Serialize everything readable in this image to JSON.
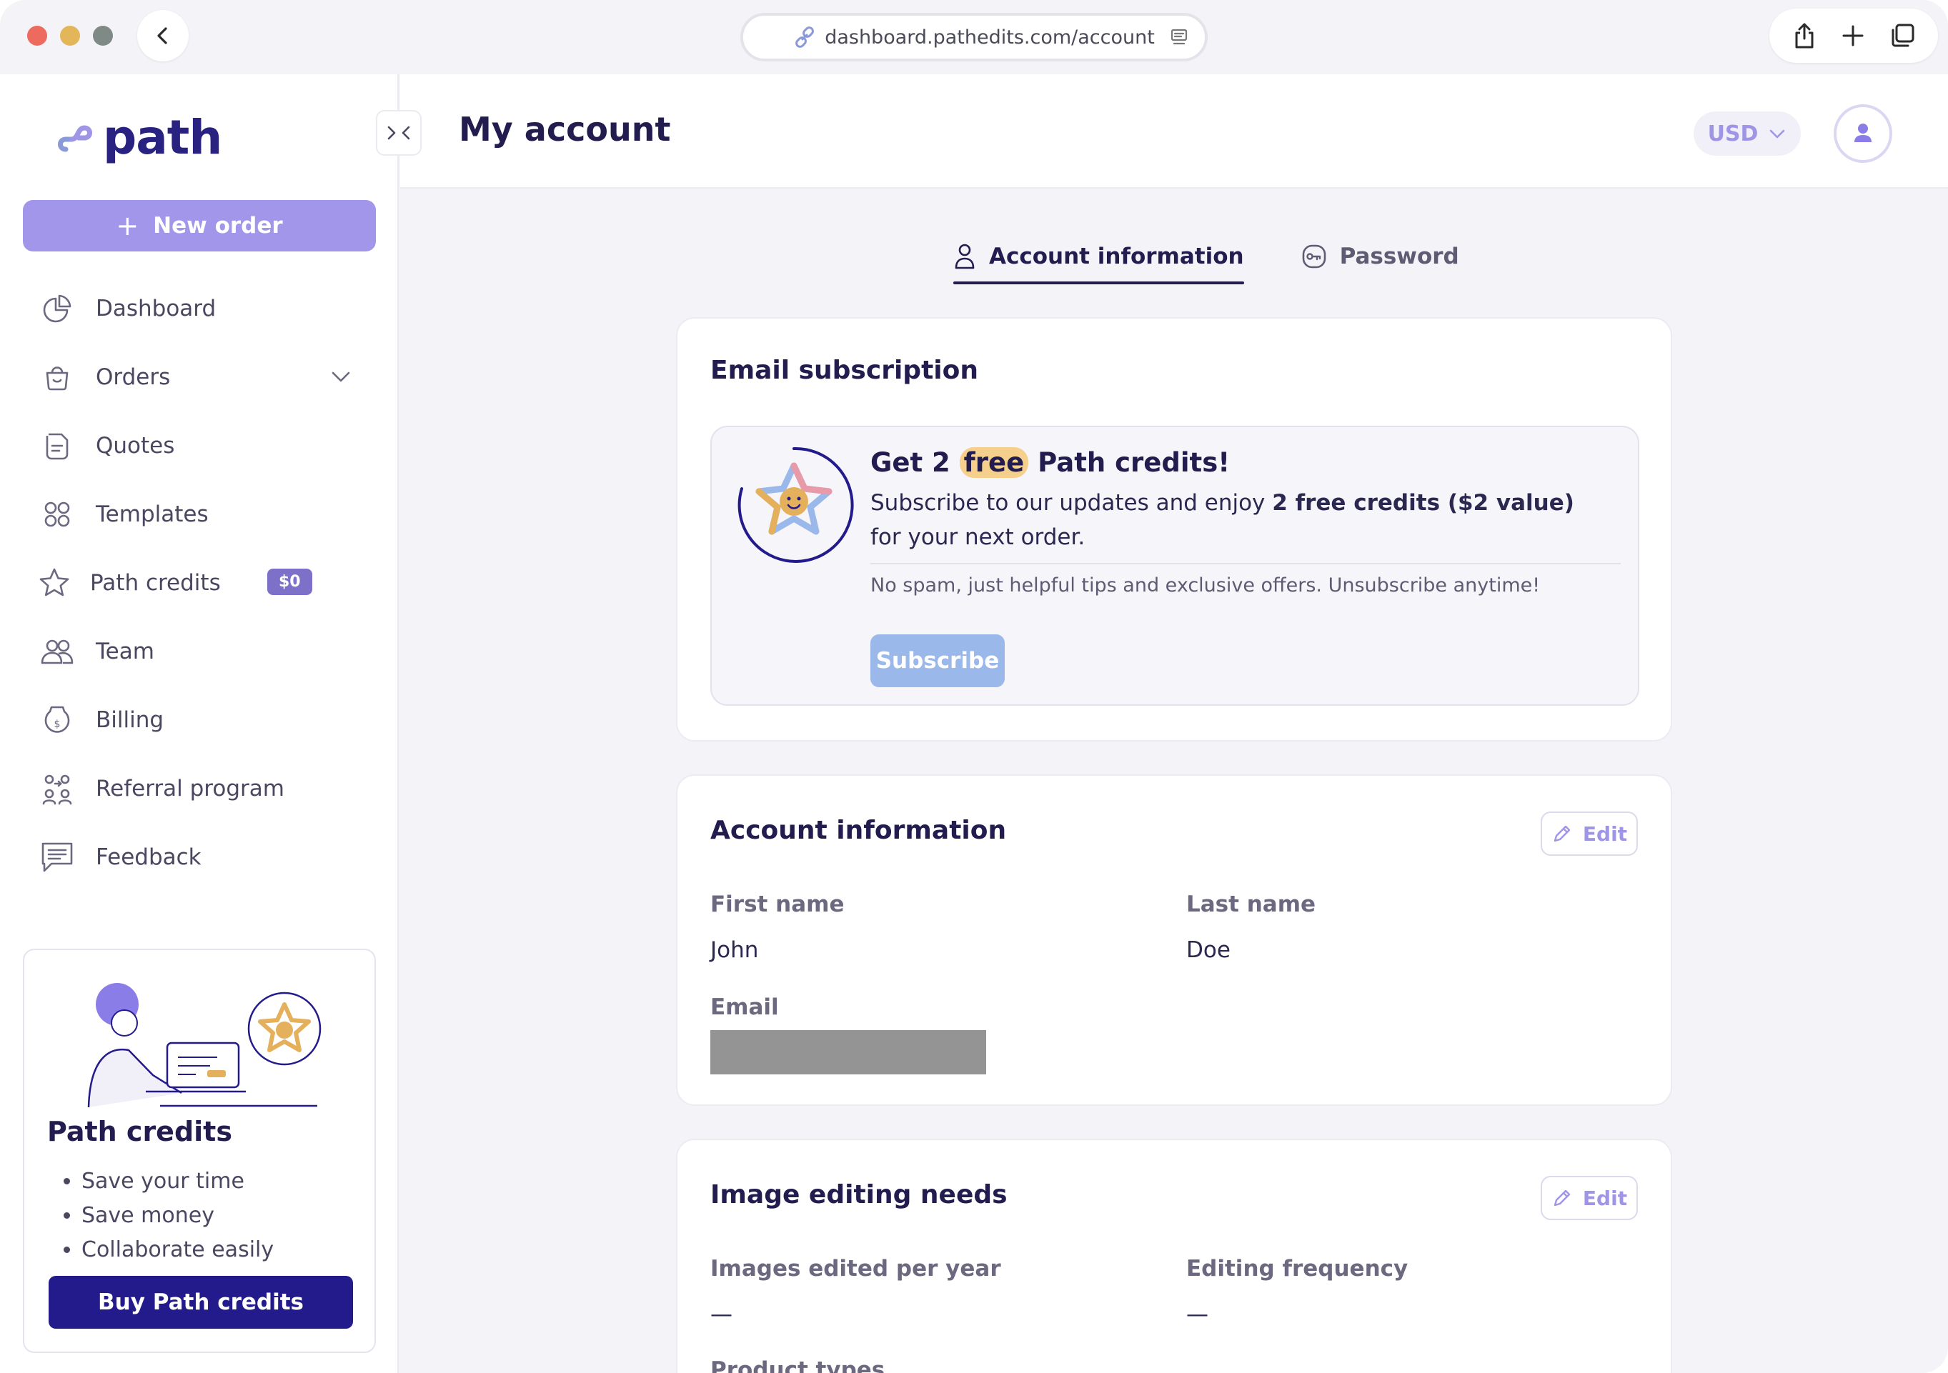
{
  "browser": {
    "url": "dashboard.pathedits.com/account"
  },
  "sidebar": {
    "logo": "path",
    "new_order_label": "New order",
    "new_order_icon": "+",
    "items": [
      {
        "label": "Dashboard",
        "icon": "pie-chart-icon"
      },
      {
        "label": "Orders",
        "icon": "basket-icon"
      },
      {
        "label": "Quotes",
        "icon": "document-icon"
      },
      {
        "label": "Templates",
        "icon": "grid-icon"
      },
      {
        "label": "Path credits",
        "icon": "star-icon",
        "badge": "$0"
      },
      {
        "label": "Team",
        "icon": "team-icon"
      },
      {
        "label": "Billing",
        "icon": "billing-icon"
      },
      {
        "label": "Referral program",
        "icon": "referral-icon"
      },
      {
        "label": "Feedback",
        "icon": "feedback-icon"
      }
    ],
    "promo": {
      "title": "Path credits",
      "bullets": [
        "Save your time",
        "Save money",
        "Collaborate easily"
      ],
      "button": "Buy Path credits"
    }
  },
  "header": {
    "title": "My account",
    "currency": "USD"
  },
  "tabs": [
    {
      "label": "Account information",
      "active": true
    },
    {
      "label": "Password",
      "active": false
    }
  ],
  "email_subscription": {
    "title": "Email subscription",
    "promo_title_pre": "Get 2",
    "promo_title_highlight": "free",
    "promo_title_post": "Path credits!",
    "text_pre": "Subscribe to our updates and enjoy",
    "text_bold": "2 free credits ($2 value)",
    "text_post": "for your next order.",
    "note": "No spam, just helpful tips and exclusive offers. Unsubscribe anytime!",
    "button": "Subscribe"
  },
  "account_information": {
    "title": "Account information",
    "edit_label": "Edit",
    "first_name_label": "First name",
    "first_name": "John",
    "last_name_label": "Last name",
    "last_name": "Doe",
    "email_label": "Email"
  },
  "image_editing": {
    "title": "Image editing needs",
    "edit_label": "Edit",
    "images_label": "Images edited per year",
    "images_value": "—",
    "frequency_label": "Editing frequency",
    "frequency_value": "—",
    "product_types_label": "Product types"
  },
  "colors": {
    "accent": "#a196ea",
    "brand_dark": "#231a8c",
    "subscribe": "#9bb8ea",
    "highlight": "#f5d08c"
  }
}
